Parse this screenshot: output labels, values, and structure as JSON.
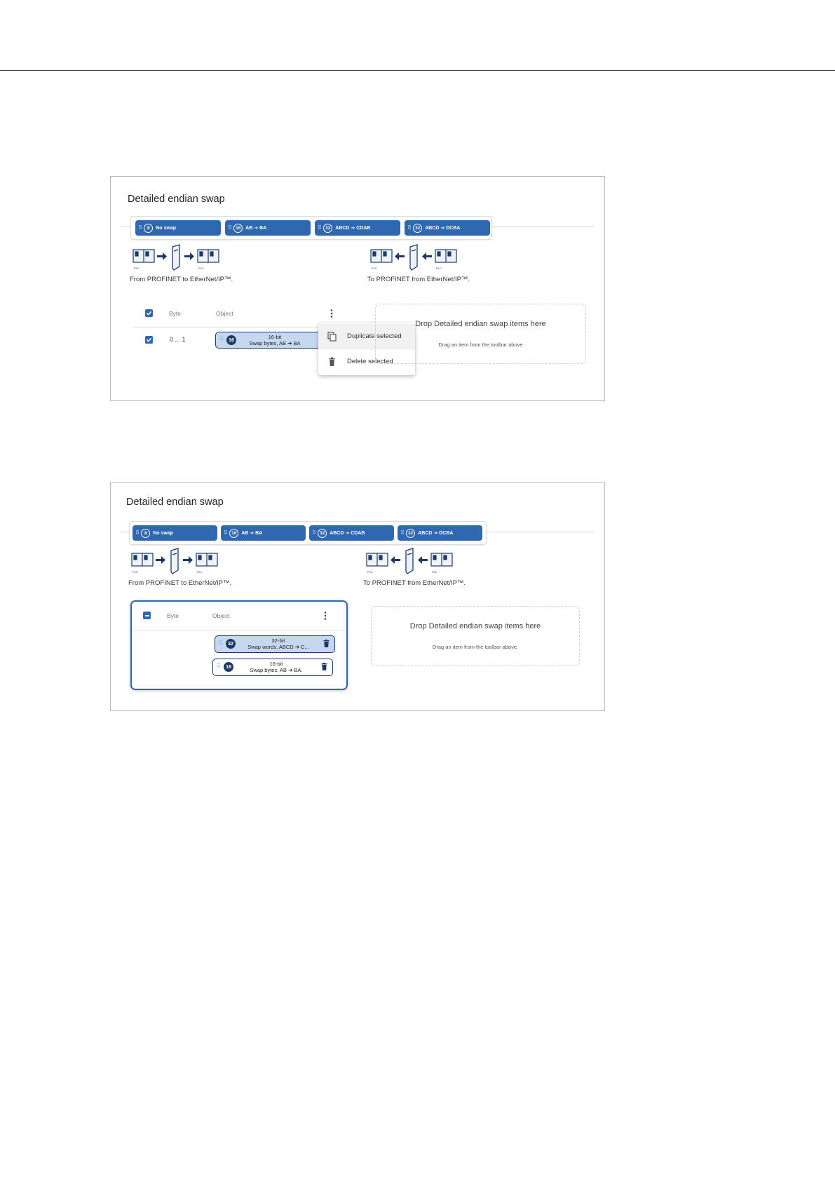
{
  "panels": [
    {
      "title": "Detailed endian swap",
      "toolbar": [
        {
          "num": "8",
          "label": "No swap"
        },
        {
          "num": "16",
          "label": "AB ➔ BA"
        },
        {
          "num": "32",
          "label": "ABCD ➔ CDAB"
        },
        {
          "num": "32",
          "label": "ABCD ➔ DCBA"
        }
      ],
      "flow_left_caption": "From PROFINET to EtherNet/IP™.",
      "flow_right_caption": "To PROFINET from EtherNet/IP™.",
      "plc_label": "PLC",
      "list": {
        "header_byte": "Byte",
        "header_object": "Object",
        "rows": [
          {
            "byte": "0 ... 1",
            "num": "16",
            "line1": "16-bit",
            "line2": "Swap bytes, AB ➔ BA"
          }
        ]
      },
      "context_menu": {
        "duplicate_label": "Duplicate selected",
        "delete_label": "Delete selected"
      },
      "dropzone": {
        "title": "Drop Detailed endian swap items here",
        "subtitle": "Drag an item from the toolbar above"
      }
    },
    {
      "title": "Detailed endian swap",
      "toolbar": [
        {
          "num": "8",
          "label": "No swap"
        },
        {
          "num": "16",
          "label": "AB ➔ BA"
        },
        {
          "num": "32",
          "label": "ABCD ➔ CDAB"
        },
        {
          "num": "32",
          "label": "ABCD ➔ DCBA"
        }
      ],
      "flow_left_caption": "From PROFINET to EtherNet/IP™.",
      "flow_right_caption": "To PROFINET from EtherNet/IP™.",
      "plc_label": "PLC",
      "list": {
        "header_byte": "Byte",
        "header_object": "Object",
        "rows": [
          {
            "num": "32",
            "line1": "32-bit",
            "line2": "Swap words, ABCD ➔ C..."
          },
          {
            "num": "16",
            "line1": "16-bit",
            "line2": "Swap bytes, AB ➔ BA."
          }
        ]
      },
      "dropzone": {
        "title": "Drop Detailed endian swap items here",
        "subtitle": "Drag an item from the toolbar above."
      }
    }
  ],
  "colors": {
    "chip_blue": "#2f67b1",
    "item_navy": "#1d3a66",
    "item_selected_bg": "#c6d8ef"
  }
}
